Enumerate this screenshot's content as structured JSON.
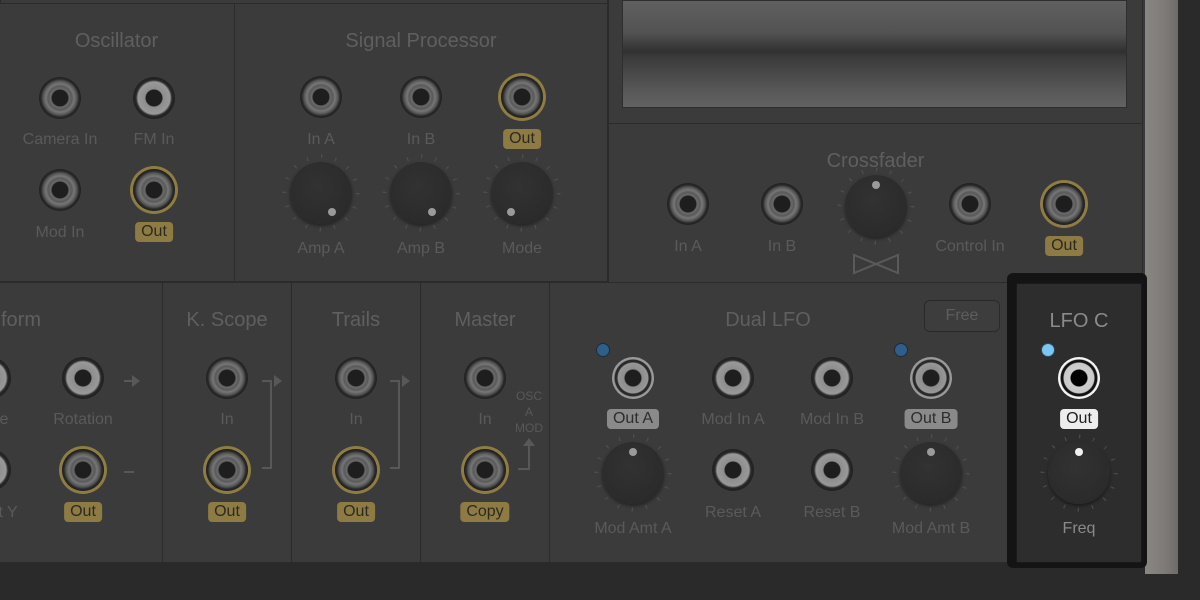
{
  "colors": {
    "panel": "#3b3b3b",
    "accent_gold": "#8d7b43",
    "led_blue": "#2f5e8a",
    "led_active": "#7cc6f2"
  },
  "modules": {
    "oscillator": {
      "title": "Oscillator",
      "jacks": [
        "Camera In",
        "FM In",
        "Mod In"
      ],
      "output": "Out"
    },
    "signal_processor": {
      "title": "Signal Processor",
      "jacks": [
        "In A",
        "In B"
      ],
      "output": "Out",
      "knobs": [
        "Amp A",
        "Amp B",
        "Mode"
      ]
    },
    "crossfader": {
      "title": "Crossfader",
      "jacks": [
        "In A",
        "In B",
        "Control In"
      ],
      "output": "Out",
      "icon": "bowtie-crossfade-icon"
    },
    "transform": {
      "title": "form",
      "jacks": [
        "e",
        "Rotation",
        "t Y"
      ],
      "output": "Out"
    },
    "k_scope": {
      "title": "K. Scope",
      "jacks": [
        "In"
      ],
      "output": "Out"
    },
    "trails": {
      "title": "Trails",
      "jacks": [
        "In"
      ],
      "output": "Out"
    },
    "master": {
      "title": "Master",
      "jacks": [
        "In"
      ],
      "output": "Copy",
      "side_label": [
        "OSC",
        "A",
        "MOD"
      ]
    },
    "dual_lfo": {
      "title": "Dual LFO",
      "mode_button": "Free",
      "outputs": [
        "Out A",
        "Out B"
      ],
      "jacks": [
        "Mod In A",
        "Mod In B",
        "Reset A",
        "Reset B"
      ],
      "knobs": [
        "Mod Amt A",
        "Mod Amt B"
      ]
    },
    "lfo_c": {
      "title": "LFO C",
      "output": "Out",
      "knobs": [
        "Freq"
      ]
    }
  }
}
